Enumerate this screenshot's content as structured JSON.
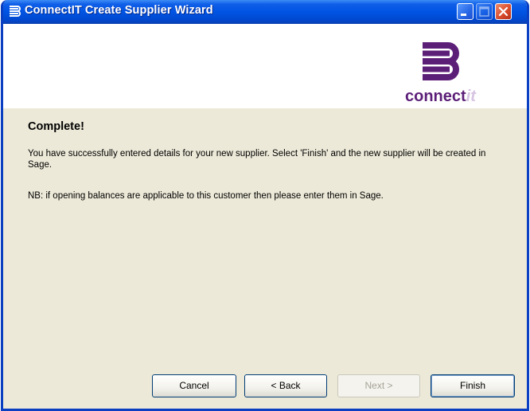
{
  "window": {
    "title": "ConnectIT Create Supplier Wizard",
    "titlebar_color": "#0054e3"
  },
  "header": {
    "logo_text": "connect",
    "logo_text_italic": "it",
    "logo_color": "#5c1f78"
  },
  "page": {
    "heading": "Complete!",
    "paragraph_1": "You have successfully entered details for your new supplier. Select 'Finish' and the new supplier will be created in Sage.",
    "paragraph_2": "NB: if opening balances are applicable to this customer then please enter them in Sage."
  },
  "buttons": {
    "cancel": "Cancel",
    "back": "< Back",
    "next": "Next >",
    "finish": "Finish",
    "next_enabled": false
  },
  "icons": {
    "app": "stacked-lines-icon",
    "minimize": "minimize-icon",
    "maximize": "maximize-icon",
    "close": "close-icon"
  }
}
